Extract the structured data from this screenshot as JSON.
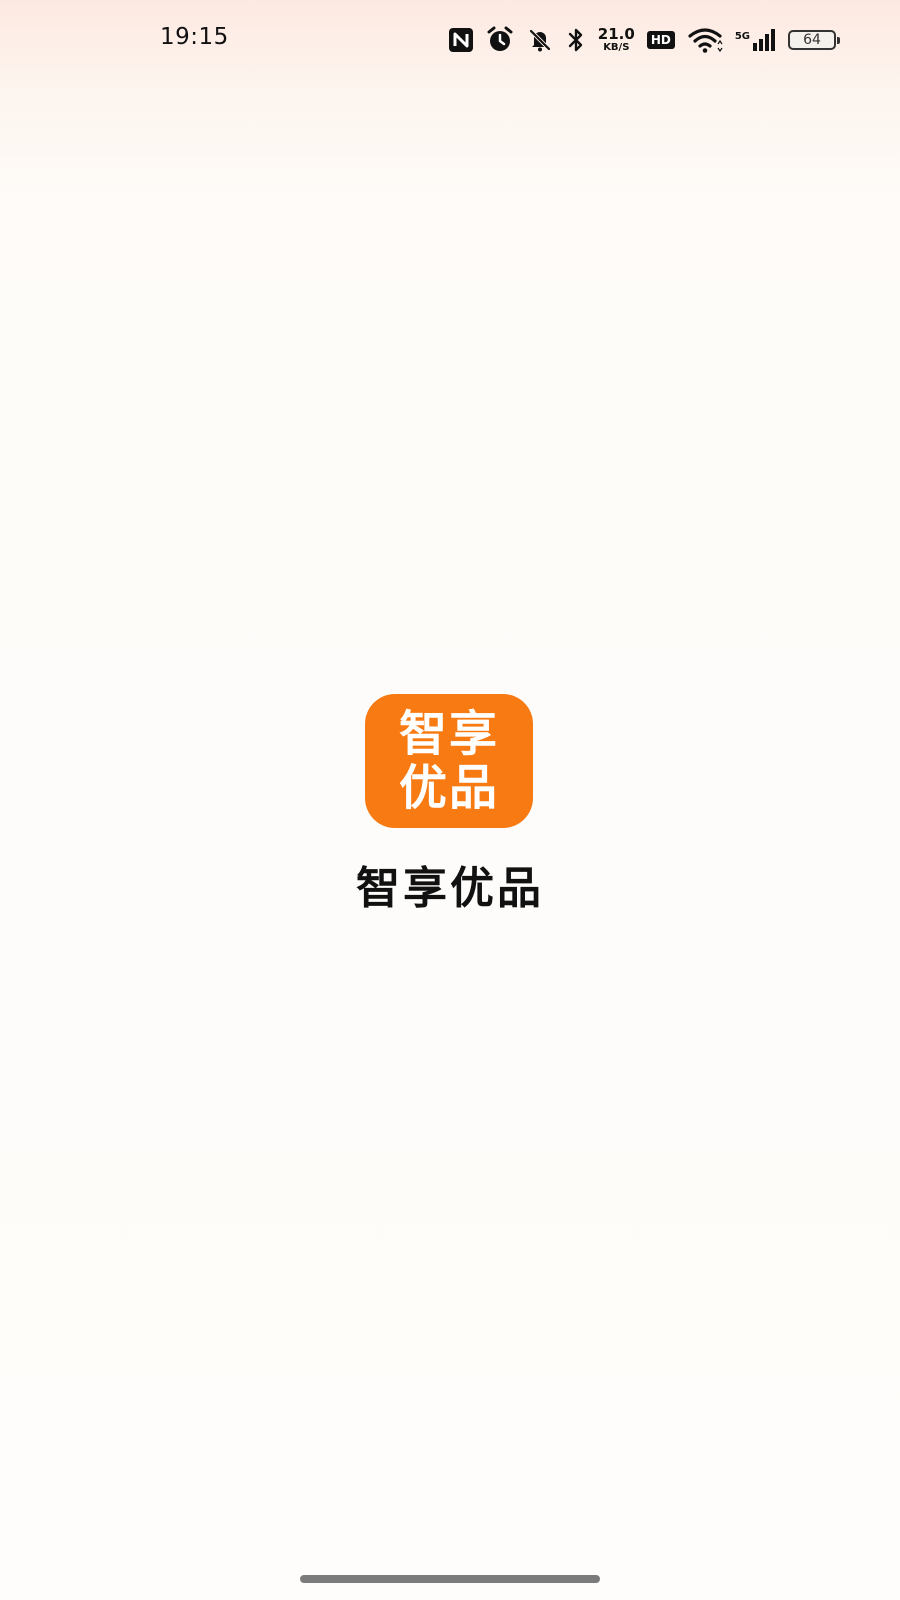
{
  "status_bar": {
    "time": "19:15",
    "net_speed_value": "21.0",
    "net_speed_unit": "KB/S",
    "hd_label": "HD",
    "network_type": "5G",
    "battery_level": "64"
  },
  "splash": {
    "icon_line1": "智享",
    "icon_line2": "优品",
    "app_name": "智享优品",
    "brand_color": "#f77a12"
  }
}
